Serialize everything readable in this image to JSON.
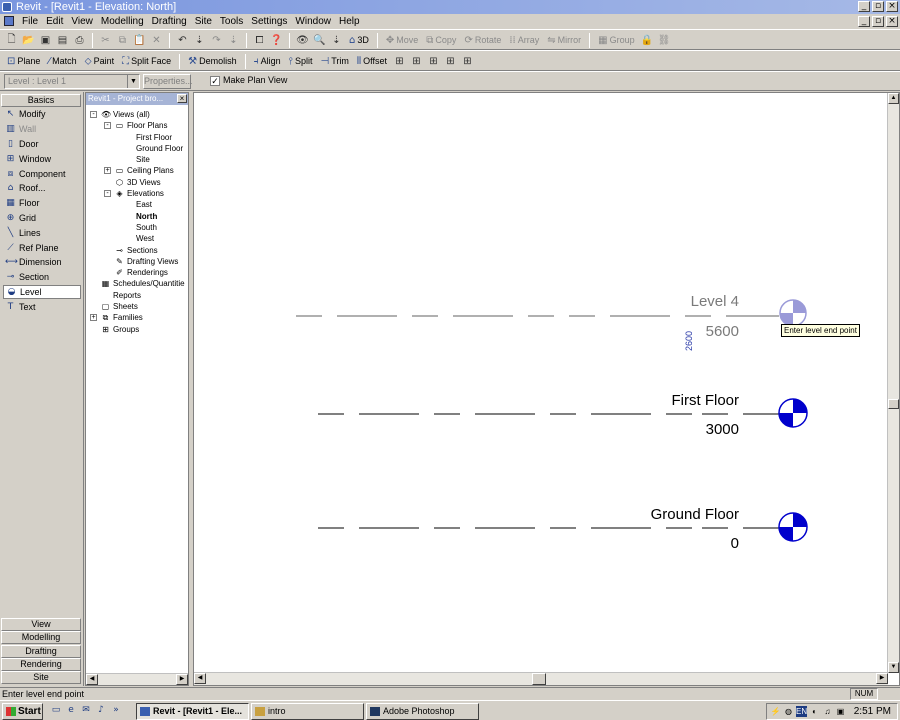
{
  "window": {
    "title": "Revit - [Revit1 - Elevation: North]",
    "minimize": "_",
    "restore": "▫",
    "close": "×"
  },
  "menu": {
    "items": [
      "File",
      "Edit",
      "View",
      "Modelling",
      "Drafting",
      "Site",
      "Tools",
      "Settings",
      "Window",
      "Help"
    ]
  },
  "toolbar1": {
    "view_3d": "3D",
    "edit_tools": [
      "Move",
      "Copy",
      "Rotate",
      "Array",
      "Mirror"
    ],
    "group": "Group"
  },
  "toolbar2": {
    "tools": [
      "Plane",
      "Match",
      "Paint",
      "Split Face",
      "Demolish",
      "Align",
      "Split",
      "Trim",
      "Offset"
    ]
  },
  "options": {
    "type_selector": "Level : Level 1",
    "properties": "Properties...",
    "make_plan_view_label": "Make Plan View",
    "make_plan_view_checked": true
  },
  "design_bar": {
    "active_tab": "Basics",
    "tools": [
      {
        "label": "Modify",
        "icon": "arrow-icon"
      },
      {
        "label": "Wall",
        "icon": "wall-icon",
        "disabled": true
      },
      {
        "label": "Door",
        "icon": "door-icon"
      },
      {
        "label": "Window",
        "icon": "window-icon"
      },
      {
        "label": "Component",
        "icon": "component-icon"
      },
      {
        "label": "Roof...",
        "icon": "roof-icon"
      },
      {
        "label": "Floor",
        "icon": "floor-icon"
      },
      {
        "label": "Grid",
        "icon": "grid-icon"
      },
      {
        "label": "Lines",
        "icon": "lines-icon"
      },
      {
        "label": "Ref Plane",
        "icon": "ref-plane-icon"
      },
      {
        "label": "Dimension",
        "icon": "dimension-icon"
      },
      {
        "label": "Section",
        "icon": "section-icon"
      },
      {
        "label": "Level",
        "icon": "level-icon",
        "active": true
      },
      {
        "label": "Text",
        "icon": "text-icon"
      }
    ],
    "bottom_tabs": [
      "View",
      "Modelling",
      "Drafting",
      "Rendering",
      "Site"
    ]
  },
  "project_browser": {
    "title": "Revit1 - Project bro...",
    "tree": [
      {
        "label": "Views (all)",
        "level": 0,
        "toggle": "-",
        "icon": "eye-icon"
      },
      {
        "label": "Floor Plans",
        "level": 1,
        "toggle": "-",
        "icon": "floor-plan-icon"
      },
      {
        "label": "First Floor",
        "level": 2
      },
      {
        "label": "Ground Floor",
        "level": 2
      },
      {
        "label": "Site",
        "level": 2
      },
      {
        "label": "Ceiling Plans",
        "level": 1,
        "toggle": "+",
        "icon": "ceiling-plan-icon"
      },
      {
        "label": "3D Views",
        "level": 1,
        "icon": "3d-view-icon"
      },
      {
        "label": "Elevations",
        "level": 1,
        "toggle": "-",
        "icon": "elevation-icon"
      },
      {
        "label": "East",
        "level": 2
      },
      {
        "label": "North",
        "level": 2,
        "bold": true
      },
      {
        "label": "South",
        "level": 2
      },
      {
        "label": "West",
        "level": 2
      },
      {
        "label": "Sections",
        "level": 1,
        "icon": "section-icon"
      },
      {
        "label": "Drafting Views",
        "level": 1,
        "icon": "drafting-icon"
      },
      {
        "label": "Renderings",
        "level": 1,
        "icon": "rendering-icon"
      },
      {
        "label": "Schedules/Quantitie",
        "level": 0,
        "icon": "schedule-icon"
      },
      {
        "label": "Reports",
        "level": 0,
        "icon": "report-icon"
      },
      {
        "label": "Sheets",
        "level": 0,
        "icon": "sheet-icon"
      },
      {
        "label": "Families",
        "level": 0,
        "toggle": "+",
        "icon": "family-icon"
      },
      {
        "label": "Groups",
        "level": 0,
        "icon": "group-icon"
      }
    ]
  },
  "drawing": {
    "levels": [
      {
        "name": "Level 4",
        "elevation": "5600",
        "state": "placing",
        "color": "#7a7a7a"
      },
      {
        "name": "First Floor",
        "elevation": "3000",
        "state": "normal",
        "color": "#000000"
      },
      {
        "name": "Ground Floor",
        "elevation": "0",
        "state": "normal",
        "color": "#000000"
      }
    ],
    "temp_dimension": "2600",
    "tooltip": "Enter level end point",
    "head_color": "#0000cc"
  },
  "status": {
    "text": "Enter level end point",
    "num": "NUM"
  },
  "taskbar": {
    "start": "Start",
    "tasks": [
      "Revit - [Revit1 - Ele...",
      "intro",
      "Adobe Photoshop"
    ],
    "lang": "EN",
    "clock": "2:51 PM"
  }
}
